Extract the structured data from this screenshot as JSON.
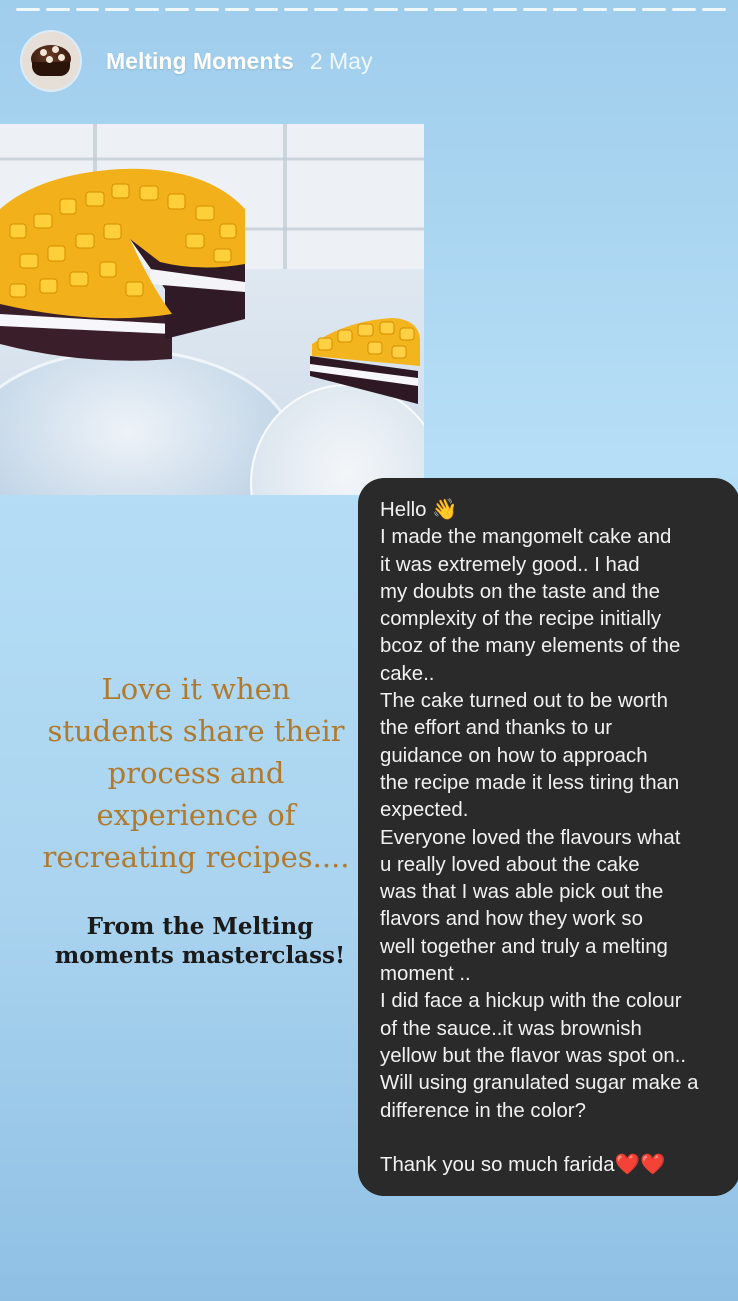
{
  "story": {
    "progress_segments": 24,
    "username": "Melting Moments",
    "posted": "2 May"
  },
  "caption": {
    "text": "Love it when students share their process and experience of recreating recipes....",
    "subtext": "From the Melting moments masterclass!"
  },
  "message": {
    "greeting": "Hello 👋",
    "body": "I made the mangomelt cake and\nit was extremely good..  I had\nmy   doubts on the taste and the\ncomplexity of the recipe initially\nbcoz of the many elements of the\ncake..\nThe cake turned out to be worth\nthe effort and thanks to ur\nguidance on how to approach\nthe recipe made it less tiring than\nexpected.\nEveryone loved the flavours what\nu really loved about the cake\nwas that I was able pick out the\nflavors and how they work so\nwell together and truly a melting\nmoment ..\nI did face a hickup with the colour\nof the sauce..it was brownish\nyellow but the flavor was spot on..\nWill using granulated sugar make a\ndifference in the color?",
    "closing": "Thank you so much farida❤️❤️"
  },
  "colors": {
    "caption": "#b07a2e",
    "bubble": "#2a2a2a",
    "background": "#b6def6"
  }
}
